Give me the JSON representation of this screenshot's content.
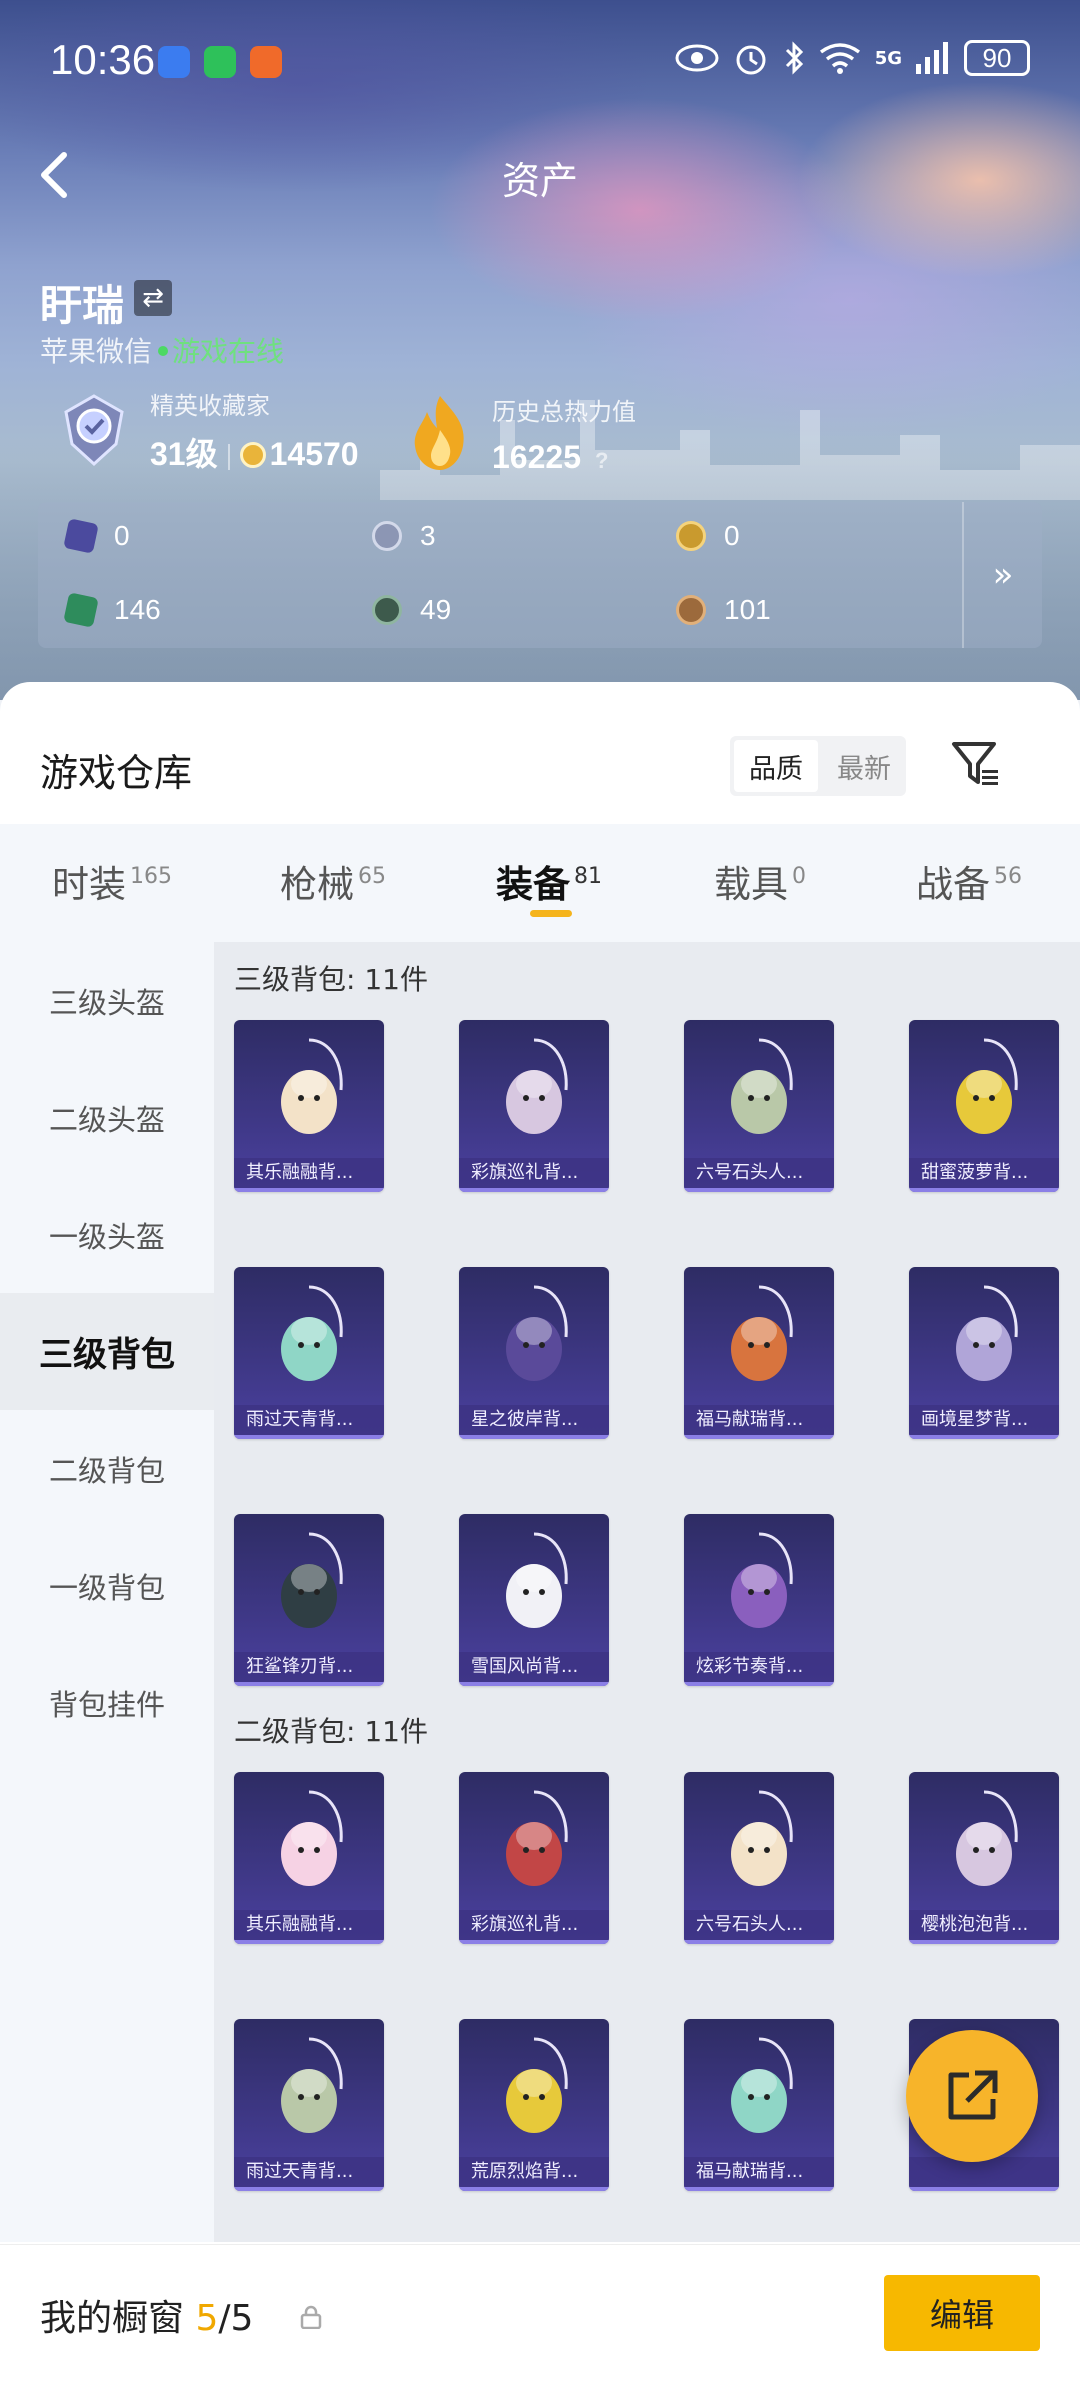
{
  "status_bar": {
    "time": "10:36",
    "battery": "90",
    "network": "5G"
  },
  "header": {
    "title": "资产"
  },
  "user": {
    "name": "盱瑞",
    "platform": "苹果微信",
    "online_status": "游戏在线",
    "rank_label": "精英收藏家",
    "level": "31级",
    "coins": "14570",
    "heat_label": "历史总热力值",
    "heat_value": "16225",
    "heat_help": "?"
  },
  "currencies": [
    {
      "icon": "purple-card-icon",
      "value": "0"
    },
    {
      "icon": "silver-coin-icon",
      "value": "3"
    },
    {
      "icon": "gold-coin-icon",
      "value": "0"
    },
    {
      "icon": "green-card-icon",
      "value": "146"
    },
    {
      "icon": "green-orb-icon",
      "value": "49"
    },
    {
      "icon": "bronze-coin-icon",
      "value": "101"
    }
  ],
  "currency_more": "»",
  "warehouse": {
    "title": "游戏仓库",
    "sort_options": [
      "品质",
      "最新"
    ],
    "sort_active": "品质",
    "tabs": [
      {
        "label": "时装",
        "count": "165"
      },
      {
        "label": "枪械",
        "count": "65"
      },
      {
        "label": "装备",
        "count": "81",
        "active": true
      },
      {
        "label": "载具",
        "count": "0"
      },
      {
        "label": "战备",
        "count": "56"
      }
    ],
    "categories": [
      "三级头盔",
      "二级头盔",
      "一级头盔",
      "三级背包",
      "二级背包",
      "一级背包",
      "背包挂件"
    ],
    "active_category": "三级背包",
    "sections": [
      {
        "title": "三级背包: 11件",
        "items": [
          "其乐融融背...",
          "彩旗巡礼背...",
          "六号石头人...",
          "甜蜜菠萝背...",
          "雨过天青背...",
          "星之彼岸背...",
          "福马献瑞背...",
          "画境星梦背...",
          "狂鲨锋刃背...",
          "雪国风尚背...",
          "炫彩节奏背..."
        ]
      },
      {
        "title": "二级背包: 11件",
        "items": [
          "其乐融融背...",
          "彩旗巡礼背...",
          "六号石头人...",
          "樱桃泡泡背...",
          "雨过天青背...",
          "荒原烈焰背...",
          "福马献瑞背...",
          ""
        ]
      }
    ]
  },
  "showcase": {
    "label": "我的橱窗",
    "current": "5",
    "total": "/5"
  },
  "edit_button": "编辑",
  "colors": {
    "accent": "#f7b800",
    "card_bg": "#3f3887",
    "online": "#4cd964"
  }
}
